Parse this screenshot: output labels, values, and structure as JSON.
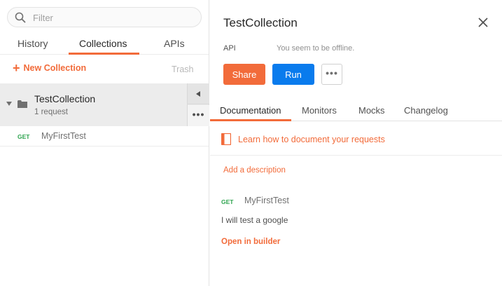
{
  "colors": {
    "accent": "#f26b3a",
    "primary_blue": "#097bed",
    "get_green": "#2ea44f"
  },
  "search": {
    "placeholder": "Filter",
    "icon": "search-icon"
  },
  "sidebar": {
    "tabs": [
      {
        "label": "History"
      },
      {
        "label": "Collections",
        "active": true
      },
      {
        "label": "APIs"
      }
    ],
    "new_collection_label": "New Collection",
    "trash_label": "Trash",
    "collection": {
      "name": "TestCollection",
      "count": "1 request",
      "requests": [
        {
          "method": "GET",
          "name": "MyFirstTest"
        }
      ]
    }
  },
  "panel": {
    "title": "TestCollection",
    "api_label": "API",
    "offline_message": "You seem to be offline.",
    "share_label": "Share",
    "run_label": "Run",
    "tabs": [
      {
        "label": "Documentation",
        "active": true
      },
      {
        "label": "Monitors"
      },
      {
        "label": "Mocks"
      },
      {
        "label": "Changelog"
      }
    ],
    "learn_link": "Learn how to document your requests",
    "add_description": "Add a description",
    "request": {
      "method": "GET",
      "name": "MyFirstTest",
      "description": "I will test a google",
      "open_in_builder": "Open in builder"
    }
  }
}
